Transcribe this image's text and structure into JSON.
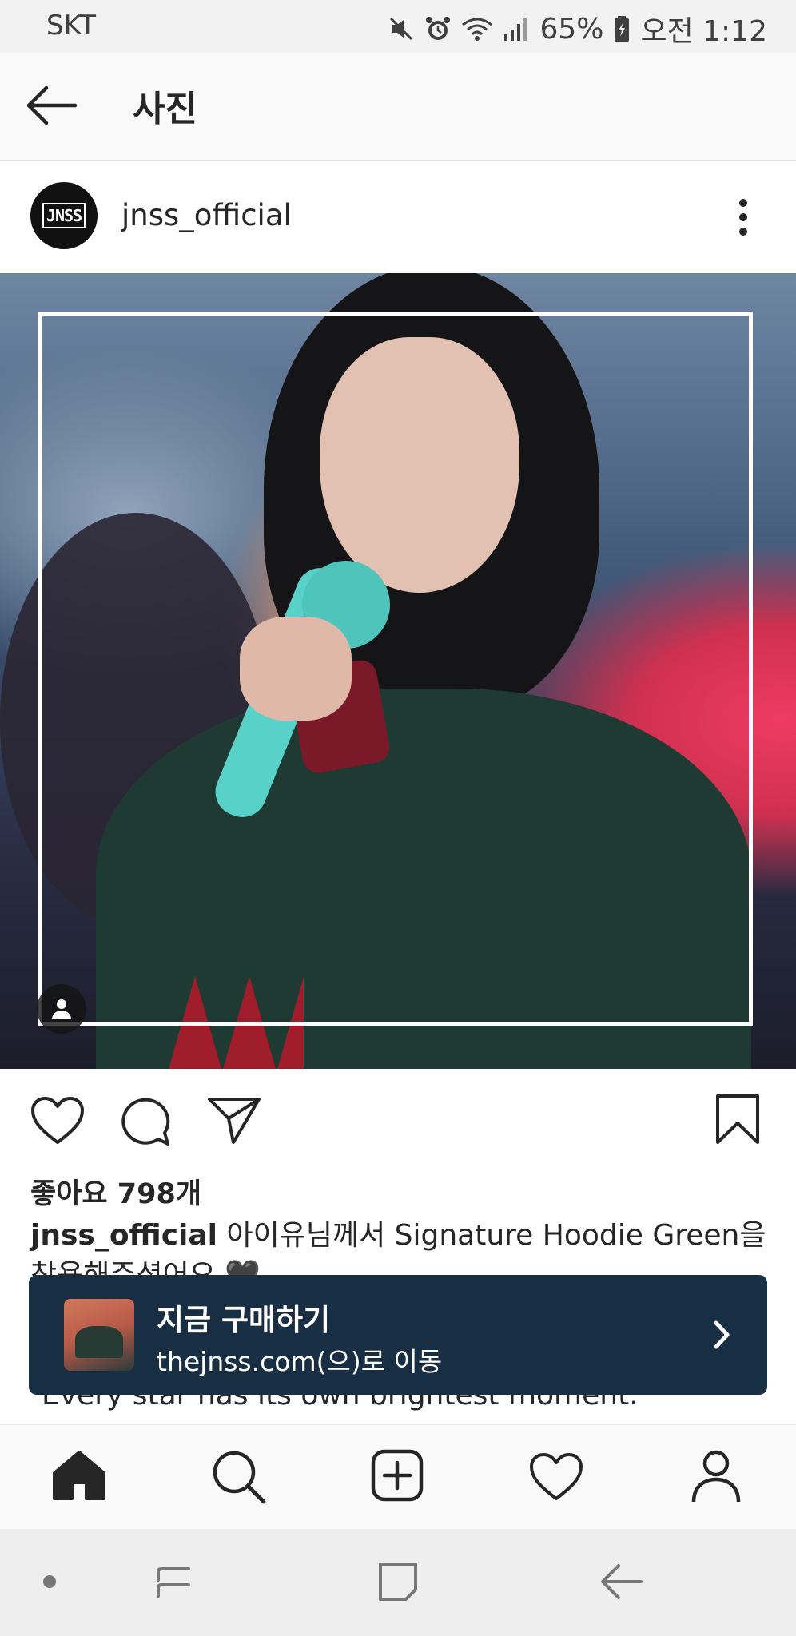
{
  "status_bar": {
    "carrier": "SKT",
    "battery": "65%",
    "time": "오전 1:12",
    "icons": [
      "mute-icon",
      "alarm-icon",
      "wifi-icon",
      "signal-icon",
      "battery-icon"
    ]
  },
  "header": {
    "title": "사진"
  },
  "post": {
    "avatar_text": "JNSS",
    "username": "jnss_official",
    "likes": "좋아요 798개",
    "caption_username": "jnss_official",
    "caption_text": " 아이유님께서 Signature Hoodie Green을 착용해주셨어요 🖤",
    "caption_more": "Every star has its own brightest moment."
  },
  "promo": {
    "title": "지금 구매하기",
    "subtitle": "thejnss.com(으)로 이동"
  },
  "colors": {
    "promo_bg": "#182e43",
    "text": "#262626"
  }
}
